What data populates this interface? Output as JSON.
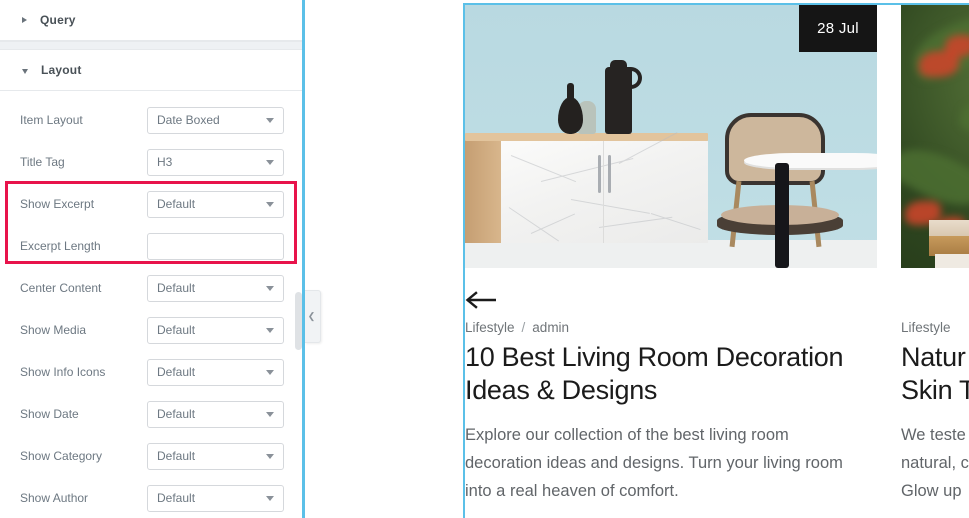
{
  "panel": {
    "sections": [
      {
        "id": "query",
        "label": "Query",
        "expanded": false,
        "caret": "chevron-right-icon"
      },
      {
        "id": "layout",
        "label": "Layout",
        "expanded": true,
        "caret": "chevron-down-icon"
      }
    ],
    "controls": [
      {
        "label": "Item Layout",
        "type": "select",
        "value": "Date Boxed",
        "placeholder": ""
      },
      {
        "label": "Title Tag",
        "type": "select",
        "value": "H3",
        "placeholder": ""
      },
      {
        "label": "Show Excerpt",
        "type": "select",
        "value": "Default",
        "placeholder": ""
      },
      {
        "label": "Excerpt Length",
        "type": "text",
        "value": "",
        "placeholder": ""
      },
      {
        "label": "Center Content",
        "type": "select",
        "value": "Default",
        "placeholder": ""
      },
      {
        "label": "Show Media",
        "type": "select",
        "value": "Default",
        "placeholder": ""
      },
      {
        "label": "Show Info Icons",
        "type": "select",
        "value": "Default",
        "placeholder": ""
      },
      {
        "label": "Show Date",
        "type": "select",
        "value": "Default",
        "placeholder": ""
      },
      {
        "label": "Show Category",
        "type": "select",
        "value": "Default",
        "placeholder": ""
      },
      {
        "label": "Show Author",
        "type": "select",
        "value": "Default",
        "placeholder": ""
      }
    ],
    "collapse_tab": {
      "icon": "chevron-left-icon",
      "glyph": "❮"
    },
    "highlight_color": "#e8134b",
    "edge_color": "#5bc0e8"
  },
  "preview": {
    "cards": [
      {
        "date_badge": "28 Jul",
        "back_icon": "arrow-left-icon",
        "category": "Lifestyle",
        "separator": "/",
        "author": "admin",
        "title_lines": [
          "10 Best Living Room Decoration",
          "Ideas & Designs"
        ],
        "excerpt_lines": [
          "Explore our collection of the best living room",
          "decoration ideas and designs. Turn your living room",
          "into a real heaven of comfort."
        ]
      },
      {
        "date_badge": "",
        "back_icon": "",
        "category": "Lifestyle",
        "separator": "",
        "author": "",
        "title_lines": [
          "Natur",
          "Skin T"
        ],
        "excerpt_lines": [
          "We teste",
          "natural, c",
          "Glow up"
        ]
      }
    ]
  }
}
